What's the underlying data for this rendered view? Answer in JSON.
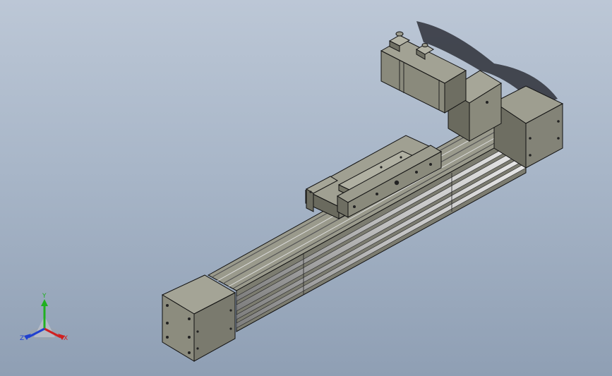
{
  "viewport": {
    "background_top": "#bcc7d6",
    "background_bottom": "#8f9fb4"
  },
  "model": {
    "body_color": "#8a8a7c",
    "body_light": "#a4a496",
    "body_dark": "#5e5e52",
    "edge_color": "#111111",
    "rail_color": "#c8c8c8"
  },
  "triad": {
    "x_label": "X",
    "y_label": "Y",
    "z_label": "Z",
    "x_color": "#d02020",
    "y_color": "#20b020",
    "z_color": "#2040d0"
  }
}
